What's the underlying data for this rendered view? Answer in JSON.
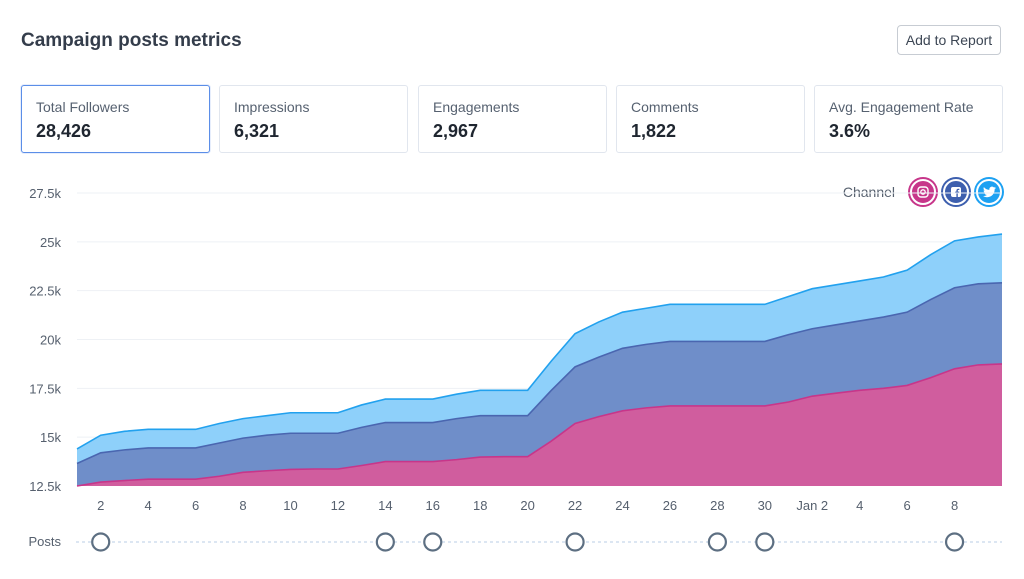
{
  "header": {
    "title": "Campaign posts metrics",
    "add_to_report_label": "Add to Report"
  },
  "metrics": [
    {
      "label": "Total Followers",
      "value": "28,426",
      "active": true
    },
    {
      "label": "Impressions",
      "value": "6,321",
      "active": false
    },
    {
      "label": "Engagements",
      "value": "2,967",
      "active": false
    },
    {
      "label": "Comments",
      "value": "1,822",
      "active": false
    },
    {
      "label": "Avg. Engagement Rate",
      "value": "3.6%",
      "active": false
    }
  ],
  "legend": {
    "label": "Channel",
    "channels": [
      {
        "name": "Instagram",
        "icon": "instagram-icon",
        "color": "#c7368a"
      },
      {
        "name": "Facebook",
        "icon": "facebook-icon",
        "color": "#3d5fae"
      },
      {
        "name": "Twitter",
        "icon": "twitter-icon",
        "color": "#1da1f2"
      }
    ]
  },
  "posts_row": {
    "label": "Posts"
  },
  "chart_data": {
    "type": "area",
    "stacked": true,
    "title": "Campaign posts metrics",
    "xlabel": "",
    "ylabel": "",
    "ylim": [
      12500,
      27500
    ],
    "yticks": [
      12500,
      15000,
      17500,
      20000,
      22500,
      25000,
      27500
    ],
    "ytick_labels": [
      "12.5k",
      "15k",
      "17.5k",
      "20k",
      "22.5k",
      "25k",
      "27.5k"
    ],
    "grid": true,
    "legend_position": "top-right",
    "x": [
      1,
      2,
      3,
      4,
      5,
      6,
      7,
      8,
      9,
      10,
      11,
      12,
      13,
      14,
      15,
      16,
      17,
      18,
      19,
      20,
      21,
      22,
      23,
      24,
      25,
      26,
      27,
      28,
      29,
      30,
      31,
      32,
      33,
      34,
      35,
      36,
      37,
      38,
      39,
      40
    ],
    "xticks": [
      2,
      4,
      6,
      8,
      10,
      12,
      14,
      16,
      18,
      20,
      22,
      24,
      26,
      28,
      30,
      32,
      34,
      36,
      38
    ],
    "xtick_labels": [
      "2",
      "4",
      "6",
      "8",
      "10",
      "12",
      "14",
      "16",
      "18",
      "20",
      "22",
      "24",
      "26",
      "28",
      "30",
      "Jan 2",
      "4",
      "6",
      "8"
    ],
    "series": [
      {
        "name": "Instagram",
        "color": "#d05d9e",
        "line": "#c7368a",
        "cumulative": [
          12500,
          12700,
          12780,
          12850,
          12850,
          12850,
          13000,
          13200,
          13280,
          13350,
          13370,
          13370,
          13550,
          13750,
          13750,
          13750,
          13850,
          13980,
          14000,
          14000,
          14800,
          15700,
          16050,
          16350,
          16500,
          16600,
          16600,
          16600,
          16600,
          16600,
          16800,
          17100,
          17250,
          17400,
          17500,
          17650,
          18050,
          18500,
          18700,
          18750
        ]
      },
      {
        "name": "Facebook",
        "color": "#6f8ec9",
        "line": "#4a66b0",
        "cumulative": [
          13650,
          14200,
          14350,
          14450,
          14450,
          14450,
          14700,
          14950,
          15100,
          15200,
          15200,
          15200,
          15500,
          15750,
          15750,
          15750,
          15950,
          16100,
          16100,
          16100,
          17400,
          18600,
          19100,
          19550,
          19750,
          19900,
          19900,
          19900,
          19900,
          19900,
          20250,
          20550,
          20750,
          20950,
          21150,
          21400,
          22050,
          22650,
          22850,
          22900
        ]
      },
      {
        "name": "Twitter",
        "color": "#8ed0fa",
        "line": "#22a1ee",
        "cumulative": [
          14400,
          15100,
          15300,
          15400,
          15400,
          15400,
          15700,
          15950,
          16100,
          16250,
          16250,
          16250,
          16650,
          16950,
          16950,
          16950,
          17200,
          17400,
          17400,
          17400,
          18900,
          20300,
          20900,
          21400,
          21600,
          21800,
          21800,
          21800,
          21800,
          21800,
          22200,
          22600,
          22800,
          23000,
          23200,
          23550,
          24350,
          25050,
          25250,
          25400
        ]
      }
    ],
    "posts_days": [
      2,
      14,
      16,
      22,
      28,
      30,
      38
    ]
  }
}
